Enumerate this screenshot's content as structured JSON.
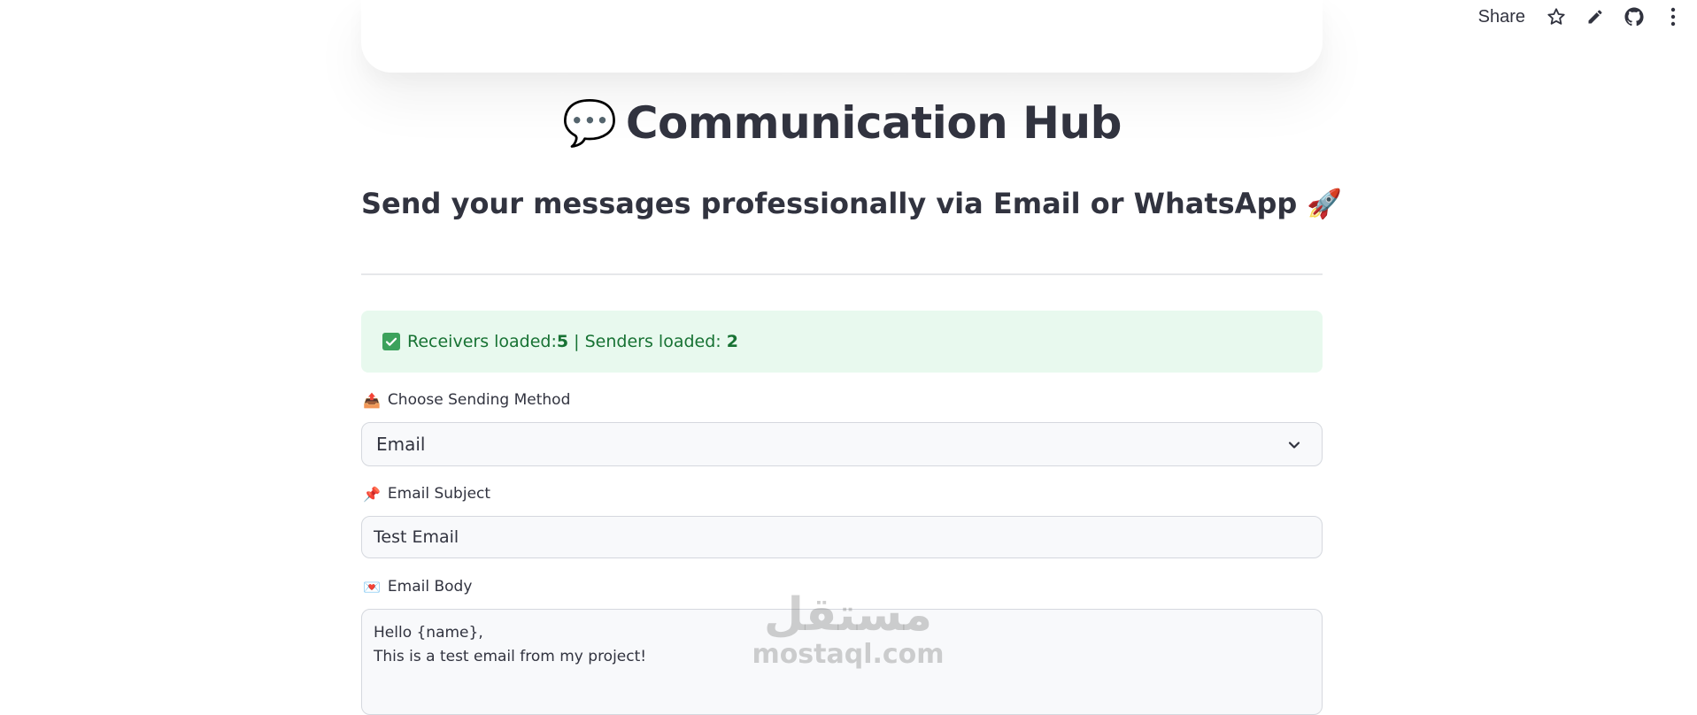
{
  "toolbar": {
    "share_label": "Share",
    "icons": [
      "star-icon",
      "pencil-icon",
      "github-icon",
      "more-vertical-icon"
    ]
  },
  "header": {
    "title_emoji": "💬",
    "title": "Communication Hub",
    "subtitle": "Send your messages professionally via Email or WhatsApp 🚀"
  },
  "status": {
    "receivers_label": "Receivers loaded: ",
    "receivers_count": "5",
    "separator": " | Senders loaded: ",
    "senders_count": "2",
    "color": "#177233",
    "background": "#e8f9ee"
  },
  "form": {
    "method": {
      "emoji": "📤",
      "label": "Choose Sending Method",
      "selected": "Email"
    },
    "subject": {
      "emoji": "📌",
      "label": "Email Subject",
      "value": "Test Email"
    },
    "body": {
      "emoji": "💌",
      "label": "Email Body",
      "value": "Hello {name},\nThis is a test email from my project!"
    }
  },
  "watermark": {
    "arabic": "مستقل",
    "latin": "mostaql.com"
  }
}
